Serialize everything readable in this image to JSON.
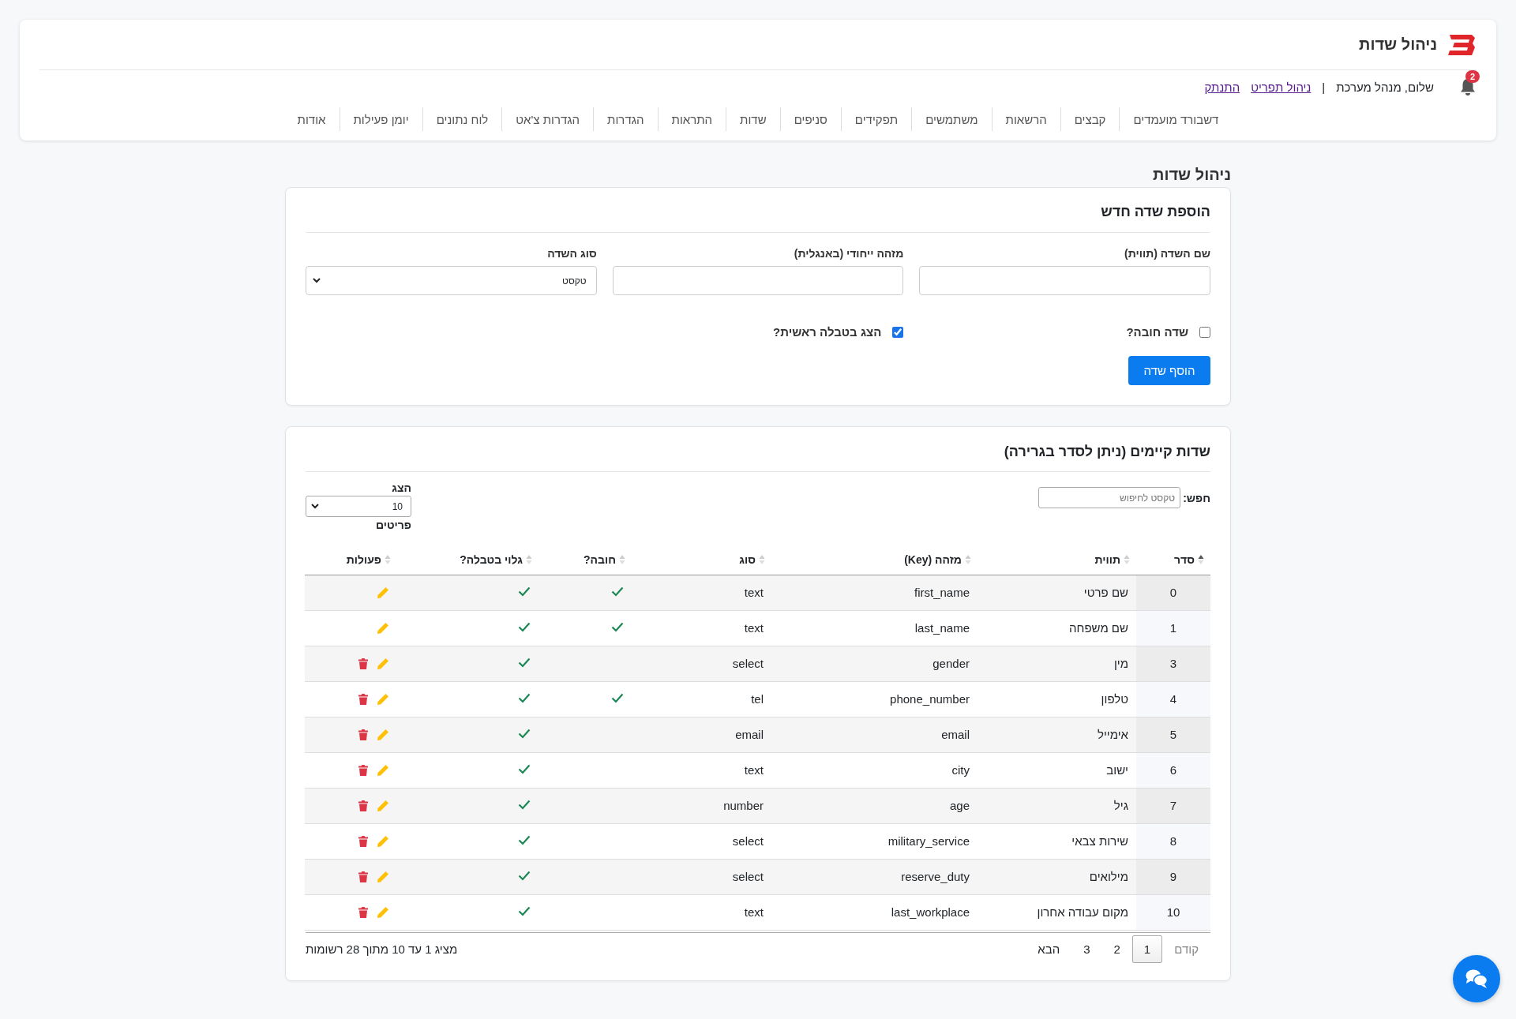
{
  "header": {
    "title": "ניהול שדות",
    "notifications": "2",
    "greeting": "שלום, מנהל מערכת",
    "separator": "|",
    "links": [
      "ניהול תפריט",
      "התנתק"
    ]
  },
  "nav": [
    "דשבורד מועמדים",
    "קבצים",
    "הרשאות",
    "משתמשים",
    "תפקידים",
    "סניפים",
    "שדות",
    "התראות",
    "הגדרות",
    "הגדרות צ'אט",
    "לוח נתונים",
    "יומן פעילות",
    "אודות"
  ],
  "page_title": "ניהול שדות",
  "add_form": {
    "title": "הוספת שדה חדש",
    "fields": [
      {
        "label": "שם השדה (תווית)",
        "kind": "text"
      },
      {
        "label": "מזהה ייחודי (באנגלית)",
        "kind": "text"
      },
      {
        "label": "סוג השדה",
        "kind": "select",
        "value": "טקסט"
      }
    ],
    "checkboxes": [
      {
        "label": "שדה חובה?",
        "checked": false
      },
      {
        "label": "הצג בטבלה ראשית?",
        "checked": true
      }
    ],
    "submit": "הוסף שדה"
  },
  "fields_table": {
    "title": "שדות קיימים (ניתן לסדר בגרירה)",
    "search": {
      "label": "חפש:",
      "placeholder": "טקסט לחיפוש"
    },
    "page_size": {
      "before": "הצג",
      "value": "10",
      "after": "פריטים"
    },
    "columns": [
      {
        "label": "סדר",
        "sorted": true
      },
      {
        "label": "תווית",
        "sorted": false
      },
      {
        "label": "מזהה (Key)",
        "sorted": false
      },
      {
        "label": "סוג",
        "sorted": false
      },
      {
        "label": "חובה?",
        "sorted": false
      },
      {
        "label": "גלוי בטבלה?",
        "sorted": false
      },
      {
        "label": "פעולות",
        "sorted": false
      }
    ],
    "rows": [
      {
        "order": "0",
        "label": "שם פרטי",
        "key": "first_name",
        "type": "text",
        "required": true,
        "visible": true,
        "deletable": false
      },
      {
        "order": "1",
        "label": "שם משפחה",
        "key": "last_name",
        "type": "text",
        "required": true,
        "visible": true,
        "deletable": false
      },
      {
        "order": "3",
        "label": "מין",
        "key": "gender",
        "type": "select",
        "required": false,
        "visible": true,
        "deletable": true
      },
      {
        "order": "4",
        "label": "טלפון",
        "key": "phone_number",
        "type": "tel",
        "required": true,
        "visible": true,
        "deletable": true
      },
      {
        "order": "5",
        "label": "אימייל",
        "key": "email",
        "type": "email",
        "required": false,
        "visible": true,
        "deletable": true
      },
      {
        "order": "6",
        "label": "ישוב",
        "key": "city",
        "type": "text",
        "required": false,
        "visible": true,
        "deletable": true
      },
      {
        "order": "7",
        "label": "גיל",
        "key": "age",
        "type": "number",
        "required": false,
        "visible": true,
        "deletable": true
      },
      {
        "order": "8",
        "label": "שירות צבאי",
        "key": "military_service",
        "type": "select",
        "required": false,
        "visible": true,
        "deletable": true
      },
      {
        "order": "9",
        "label": "מילואים",
        "key": "reserve_duty",
        "type": "select",
        "required": false,
        "visible": true,
        "deletable": true
      },
      {
        "order": "10",
        "label": "מקום עבודה אחרון",
        "key": "last_workplace",
        "type": "text",
        "required": false,
        "visible": true,
        "deletable": true
      }
    ],
    "info": "מציג 1 עד 10 מתוך 28 רשומות",
    "pagination": {
      "prev": {
        "label": "קודם",
        "disabled": true
      },
      "pages": [
        {
          "label": "1",
          "selected": true
        },
        {
          "label": "2",
          "selected": false
        },
        {
          "label": "3",
          "selected": false
        }
      ],
      "next": {
        "label": "הבא",
        "disabled": false
      }
    }
  }
}
